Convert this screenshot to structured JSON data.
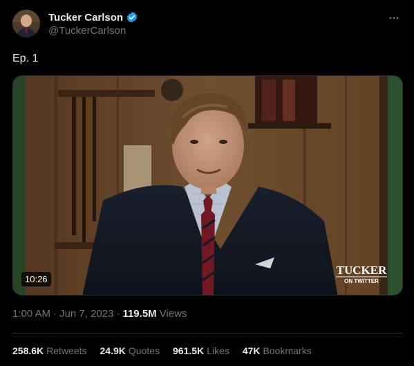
{
  "author": {
    "name": "Tucker Carlson",
    "handle": "@TuckerCarlson",
    "verified_color": "#1d9bf0"
  },
  "tweet": {
    "text": "Ep. 1",
    "time": "1:00 AM",
    "separator": "·",
    "date": "Jun 7, 2023",
    "views_count": "119.5M",
    "views_label": "Views"
  },
  "video": {
    "duration": "10:26",
    "watermark_title": "TUCKER",
    "watermark_subtitle": "ON TWITTER"
  },
  "stats": [
    {
      "count": "258.6K",
      "label": "Retweets"
    },
    {
      "count": "24.9K",
      "label": "Quotes"
    },
    {
      "count": "961.5K",
      "label": "Likes"
    },
    {
      "count": "47K",
      "label": "Bookmarks"
    }
  ],
  "more_icon": "ellipsis-icon"
}
